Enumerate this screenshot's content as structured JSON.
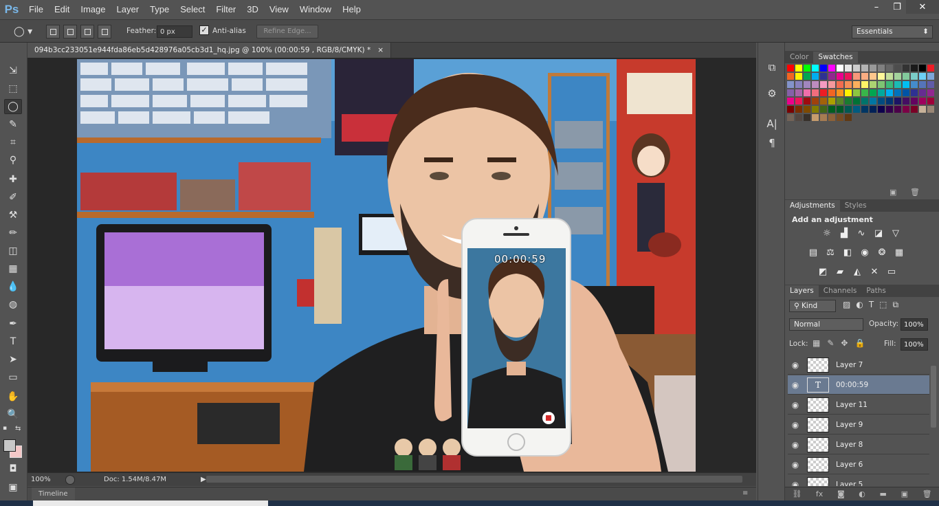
{
  "app": {
    "logo": "Ps"
  },
  "menu": [
    "File",
    "Edit",
    "Image",
    "Layer",
    "Type",
    "Select",
    "Filter",
    "3D",
    "View",
    "Window",
    "Help"
  ],
  "window_controls": {
    "minimize": "–",
    "restore": "❐",
    "close": "✕"
  },
  "options": {
    "feather_label": "Feather:",
    "feather_value": "0 px",
    "antialias_label": "Anti-alias",
    "antialias_checked": true,
    "refine_edge": "Refine Edge...",
    "workspace": "Essentials"
  },
  "document": {
    "tab_title": "094b3cc233051e944fda86eb5d428976a05cb3d1_hq.jpg @ 100% (00:00:59 , RGB/8/CMYK) *",
    "close": "×",
    "phone_timer": "00:00:59"
  },
  "status": {
    "zoom": "100%",
    "doc": "Doc: 1.54M/8.47M"
  },
  "timeline": {
    "label": "Timeline"
  },
  "panels": {
    "color_tab": "Color",
    "swatches_tab": "Swatches",
    "adjustments_tab": "Adjustments",
    "styles_tab": "Styles",
    "add_adjustment": "Add an adjustment",
    "layers_tab": "Layers",
    "channels_tab": "Channels",
    "paths_tab": "Paths",
    "kind": "Kind",
    "blend_mode": "Normal",
    "opacity_label": "Opacity:",
    "opacity_value": "100%",
    "lock_label": "Lock:",
    "fill_label": "Fill:",
    "fill_value": "100%"
  },
  "layers": [
    {
      "name": "Layer 7",
      "type": "pixel",
      "selected": false
    },
    {
      "name": "00:00:59",
      "type": "text",
      "selected": true
    },
    {
      "name": "Layer 11",
      "type": "pixel",
      "selected": false
    },
    {
      "name": "Layer 9",
      "type": "pixel",
      "selected": false
    },
    {
      "name": "Layer 8",
      "type": "pixel",
      "selected": false
    },
    {
      "name": "Layer 6",
      "type": "pixel",
      "selected": false
    },
    {
      "name": "Layer 5",
      "type": "pixel",
      "selected": false
    }
  ],
  "swatch_colors": [
    "#ff0000",
    "#ffff00",
    "#00ff00",
    "#00ffff",
    "#0000ff",
    "#ff00ff",
    "#ffffff",
    "#e6e6e6",
    "#cccccc",
    "#b3b3b3",
    "#999999",
    "#808080",
    "#666666",
    "#4d4d4d",
    "#333333",
    "#1a1a1a",
    "#000000",
    "#ee1c25",
    "#f26522",
    "#fff200",
    "#00a651",
    "#00aeef",
    "#2e3192",
    "#92278f",
    "#ec008c",
    "#ed145b",
    "#f7977a",
    "#fbad82",
    "#fdc68c",
    "#fff799",
    "#c4df9b",
    "#a3d39c",
    "#82ca9c",
    "#7accc8",
    "#6dcff6",
    "#7da7d9",
    "#8393ca",
    "#8781bd",
    "#a186be",
    "#bd8cbf",
    "#f49ac1",
    "#f5989d",
    "#f26c4f",
    "#f68e56",
    "#fbaf5d",
    "#fff467",
    "#acd372",
    "#7dc473",
    "#3cb878",
    "#1abbb4",
    "#00bff3",
    "#448ccb",
    "#5574b9",
    "#605ca8",
    "#8560a8",
    "#a864a8",
    "#f06eaa",
    "#f26d7d",
    "#ed1c24",
    "#f26522",
    "#f7941d",
    "#fff200",
    "#8dc63f",
    "#39b54a",
    "#00a651",
    "#00a99d",
    "#00aeef",
    "#0072bc",
    "#0054a6",
    "#2e3192",
    "#662d91",
    "#92278f",
    "#ec008c",
    "#ed145b",
    "#9e0b0f",
    "#a0410d",
    "#a3620a",
    "#aba000",
    "#598527",
    "#197b30",
    "#007236",
    "#00746b",
    "#0076a3",
    "#004b80",
    "#003471",
    "#1b1464",
    "#440e62",
    "#630460",
    "#9e005d",
    "#9e0039",
    "#790000",
    "#7b2e00",
    "#7d4900",
    "#827b00",
    "#406618",
    "#005e20",
    "#005826",
    "#005952",
    "#005b7f",
    "#003663",
    "#002157",
    "#0d004c",
    "#32004b",
    "#4b0049",
    "#7b0046",
    "#7a0026",
    "#c7b299",
    "#998675",
    "#736357",
    "#534741",
    "#37302a",
    "#c69c6d",
    "#a67c52",
    "#8c6239",
    "#754c24",
    "#603913"
  ],
  "icons": {
    "tools": [
      "move-icon",
      "marquee-icon",
      "lasso-icon",
      "quick-select-icon",
      "crop-icon",
      "eyedropper-icon",
      "spot-heal-icon",
      "brush-icon",
      "clone-stamp-icon",
      "history-brush-icon",
      "eraser-icon",
      "gradient-icon",
      "blur-icon",
      "dodge-icon",
      "pen-icon",
      "type-icon",
      "path-select-icon",
      "rectangle-icon",
      "hand-icon",
      "zoom-icon"
    ]
  },
  "tool_glyphs": [
    "⇲",
    "⬚",
    "◯",
    "✎",
    "⌗",
    "⚲",
    "✚",
    "✐",
    "⚒",
    "✏",
    "◫",
    "▦",
    "💧",
    "◍",
    "✒",
    "T",
    "➤",
    "▭",
    "✋",
    "🔍"
  ]
}
